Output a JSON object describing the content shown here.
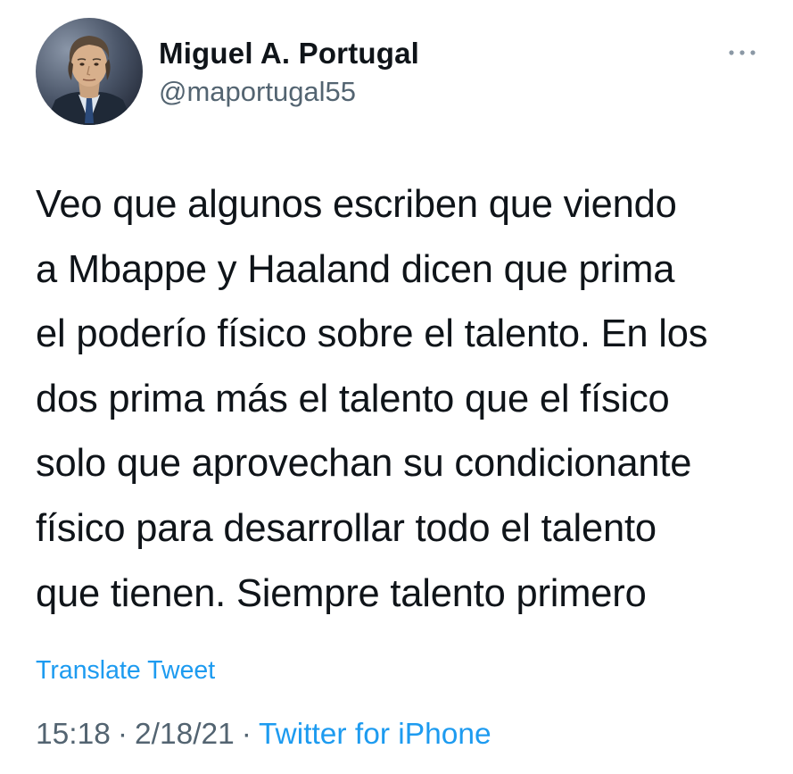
{
  "tweet": {
    "author": {
      "display_name": "Miguel A. Portugal",
      "handle": "@maportugal55",
      "avatar_icon": "profile-photo"
    },
    "more_icon": "ellipsis-icon",
    "text_lines": [
      "Veo que algunos escriben que viendo",
      "a Mbappe y Haaland dicen que prima",
      "el poderío físico sobre el talento. En los",
      "dos prima más el talento que el físico",
      "solo que aprovechan su condicionante",
      "físico para desarrollar todo el talento",
      "que tienen. Siempre talento primero"
    ],
    "translate_label": "Translate Tweet",
    "time": "15:18",
    "date": "2/18/21",
    "separator": "·",
    "source": "Twitter for iPhone"
  },
  "colors": {
    "text": "#0f1419",
    "secondary": "#536471",
    "link": "#1d9bf0",
    "background": "#ffffff"
  }
}
